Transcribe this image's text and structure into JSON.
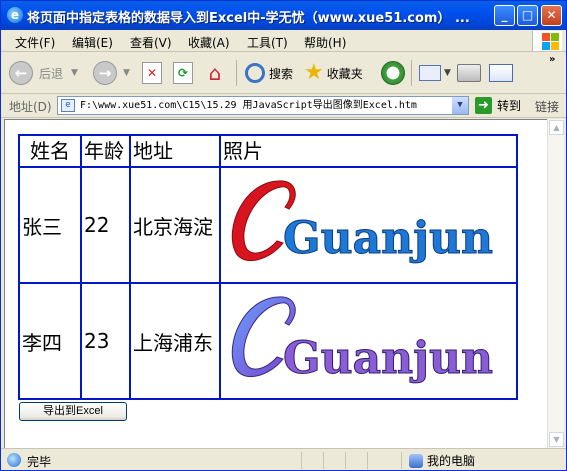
{
  "window": {
    "title": "将页面中指定表格的数据导入到Excel中-学无忧（www.xue51.com） ..."
  },
  "menu": [
    "文件(F)",
    "编辑(E)",
    "查看(V)",
    "收藏(A)",
    "工具(T)",
    "帮助(H)"
  ],
  "toolbar": {
    "back": "后退",
    "search": "搜索",
    "favorites": "收藏夹"
  },
  "address": {
    "label": "地址(D)",
    "url": "F:\\www.xue51.com\\C15\\15.29  用JavaScript导出图像到Excel.htm",
    "go": "转到",
    "links": "链接"
  },
  "table": {
    "headers": [
      "姓名",
      "年龄",
      "地址",
      "照片"
    ],
    "rows": [
      {
        "name": "张三",
        "age": "22",
        "address": "北京海淀",
        "photo": "Guanjun"
      },
      {
        "name": "李四",
        "age": "23",
        "address": "上海浦东",
        "photo": "Guanjun"
      }
    ]
  },
  "export_button": "导出到Excel",
  "status": {
    "text": "完毕",
    "zone": "我的电脑"
  },
  "colors": {
    "table_border": "#0018C8",
    "logo_red": "#D8141E",
    "logo_blue": "#1E78D6"
  }
}
